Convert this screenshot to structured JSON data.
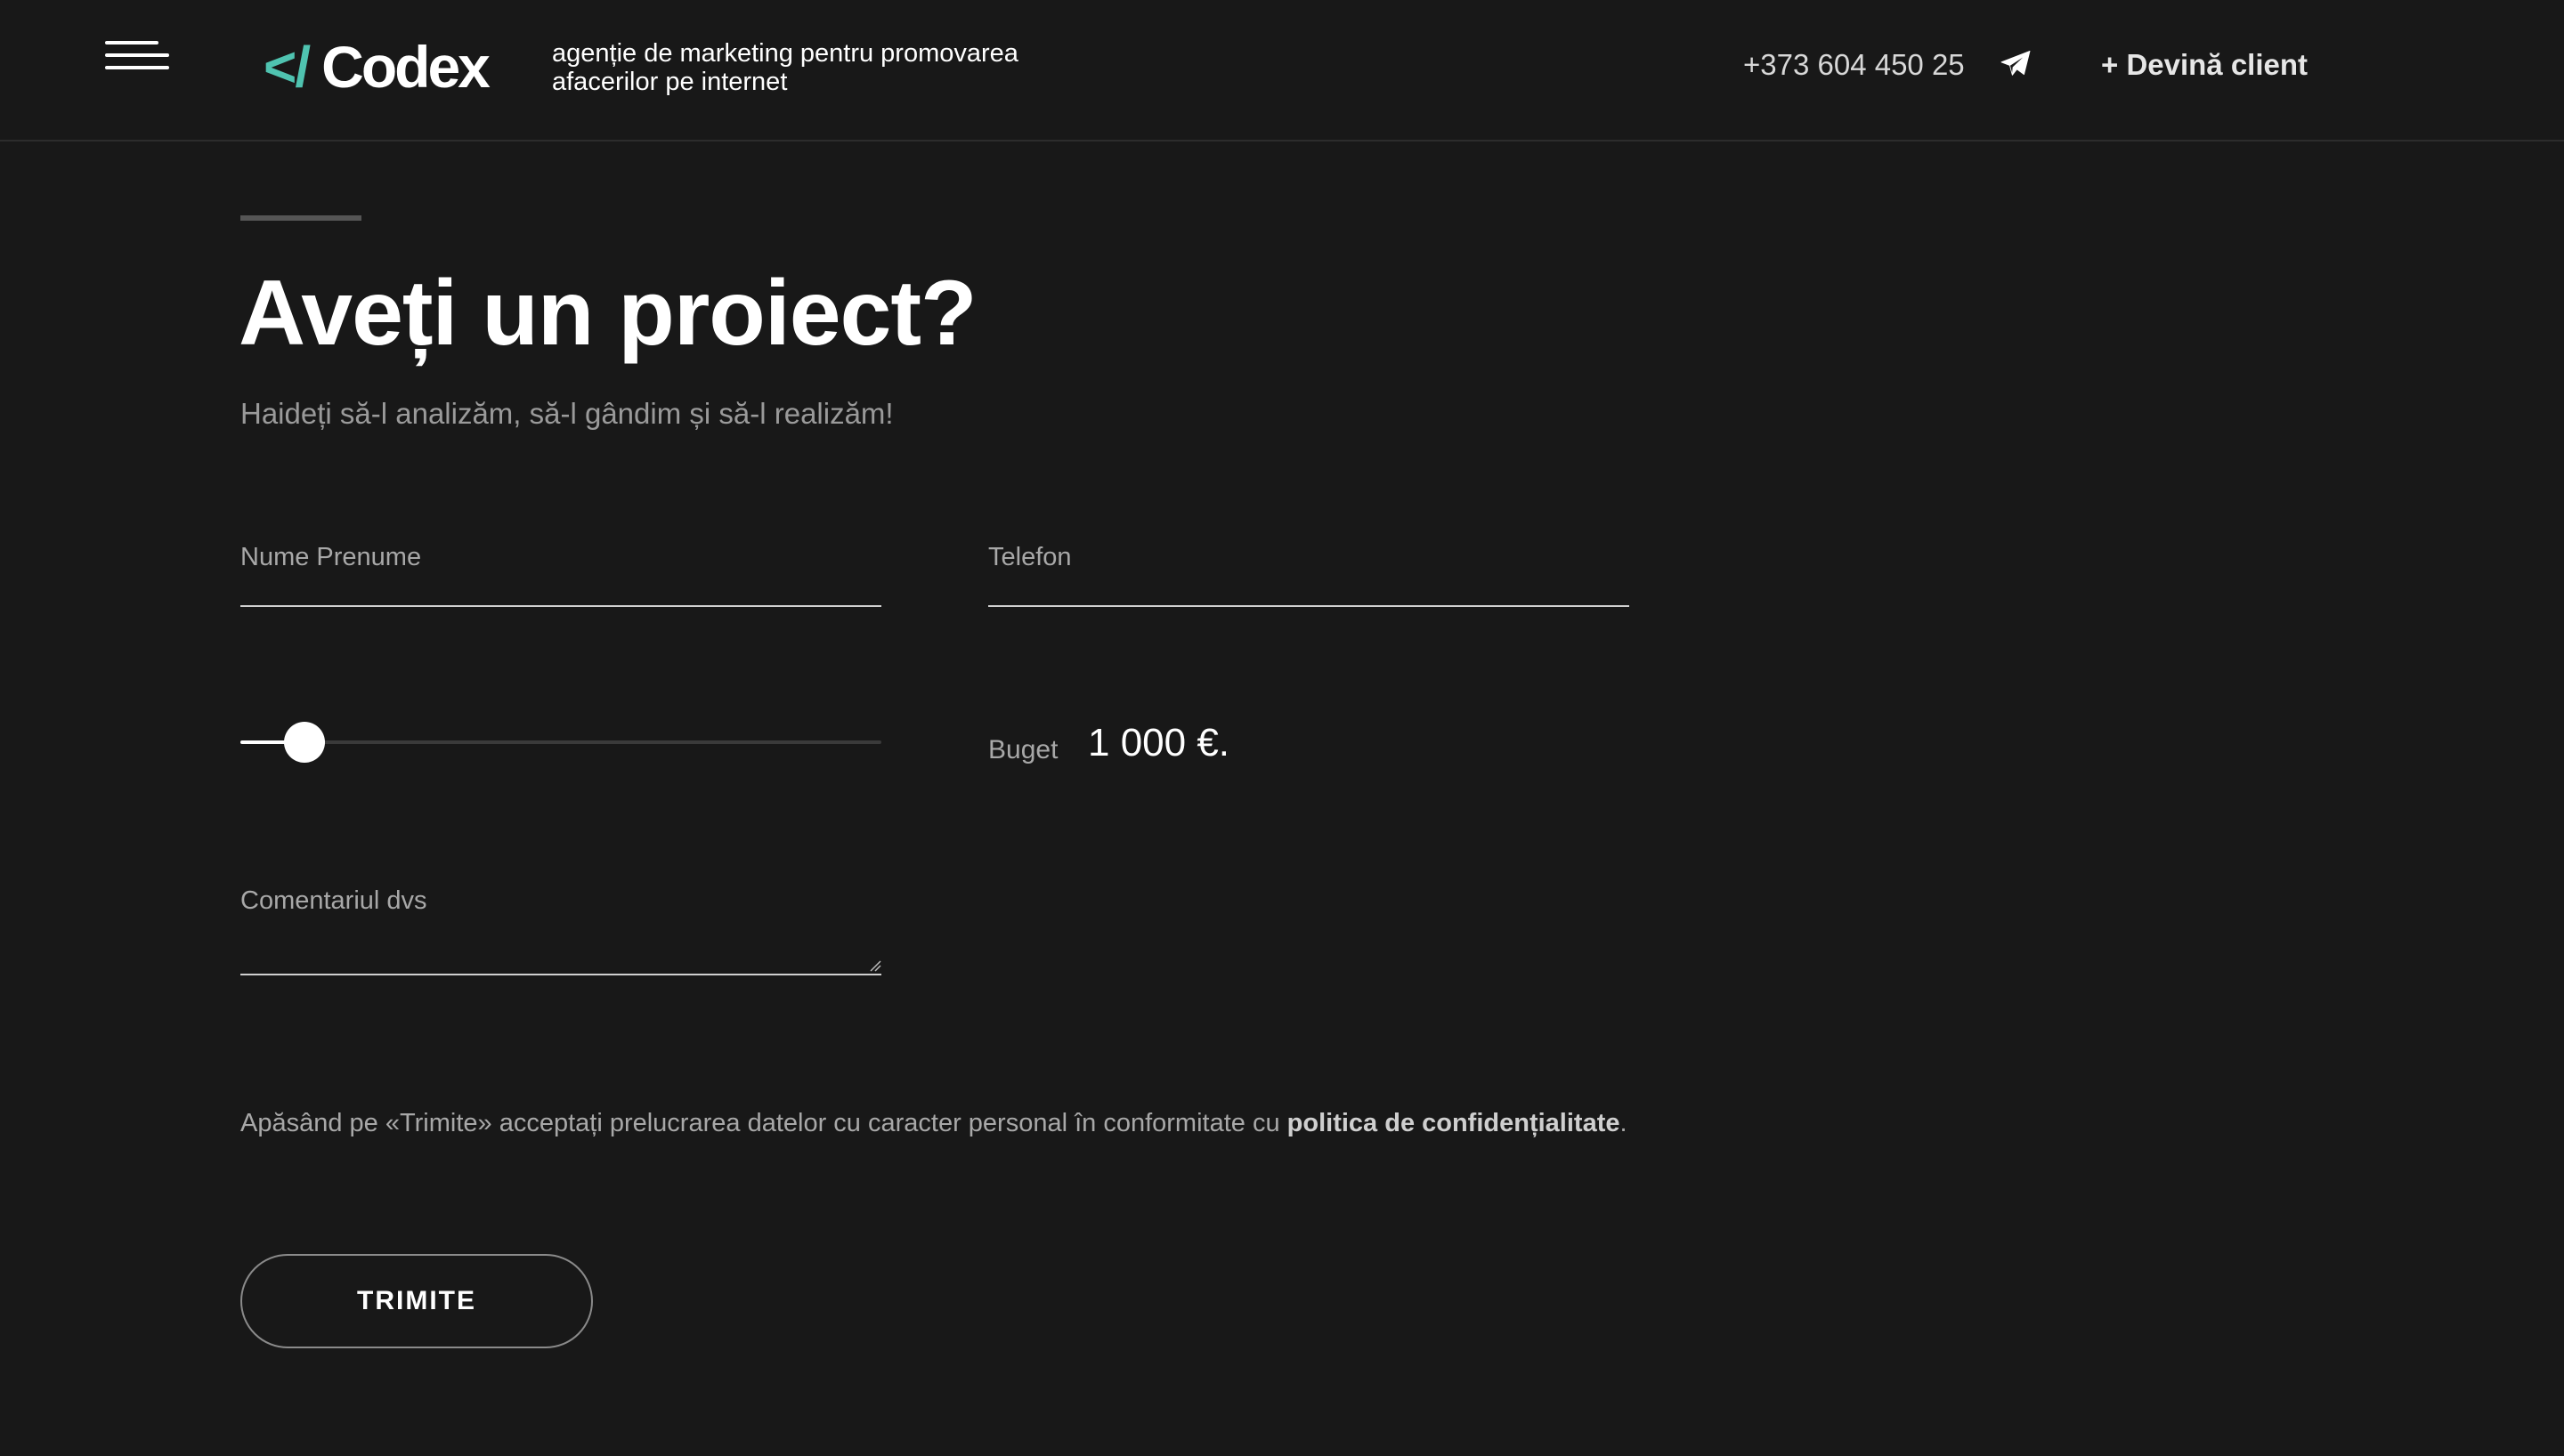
{
  "header": {
    "logo_mark": "</",
    "logo_text": "Codex",
    "tagline": "agenție de marketing pentru promovarea afacerilor pe internet",
    "phone": "+373 604 450 25",
    "cta": "+ Devină client"
  },
  "main": {
    "title": "Aveți un proiect?",
    "subtitle": "Haideți să-l analizăm, să-l gândim și să-l realizăm!",
    "fields": {
      "name_label": "Nume Prenume",
      "phone_label": "Telefon",
      "comment_label": "Comentariul dvs"
    },
    "budget": {
      "label": "Buget",
      "value_text": "1 000 €.",
      "slider_fraction": 0.1
    },
    "consent": {
      "text": "Apăsând pe «Trimite» acceptați prelucrarea datelor cu caracter personal în conformitate cu ",
      "link": "politica de confidențialitate",
      "suffix": "."
    },
    "submit_label": "TRIMITE"
  },
  "colors": {
    "background": "#181818",
    "accent": "#4fc3b0",
    "text": "#ffffff",
    "muted": "#a8a8a8"
  },
  "icons": {
    "menu": "hamburger-menu-icon",
    "telegram": "telegram-icon"
  }
}
